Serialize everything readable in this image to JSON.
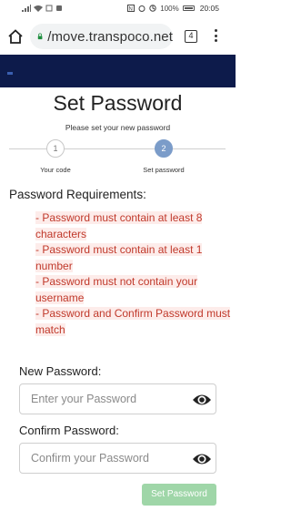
{
  "status_bar": {
    "battery": "100%",
    "time": "20:05"
  },
  "browser": {
    "url": "/move.transpoco.net",
    "tab_count": "4"
  },
  "page": {
    "title": "Set Password",
    "subtitle": "Please set your new password"
  },
  "steps": [
    {
      "number": "1",
      "label": "Your code",
      "active": false
    },
    {
      "number": "2",
      "label": "Set password",
      "active": true
    }
  ],
  "requirements": {
    "title": "Password Requirements:",
    "items": [
      "- Password must contain at least 8 characters",
      "- Password must contain at least 1 number",
      "- Password must not contain your username",
      "- Password and Confirm Password must match"
    ]
  },
  "form": {
    "new_password_label": "New Password:",
    "new_password_placeholder": "Enter your Password",
    "confirm_password_label": "Confirm Password:",
    "confirm_password_placeholder": "Confirm your Password",
    "submit_label": "Set Password"
  },
  "colors": {
    "header_band": "#0d1b4b",
    "step_active": "#7b9cc9",
    "requirement_text": "#c0392b",
    "submit_button": "#9fd6a8"
  }
}
